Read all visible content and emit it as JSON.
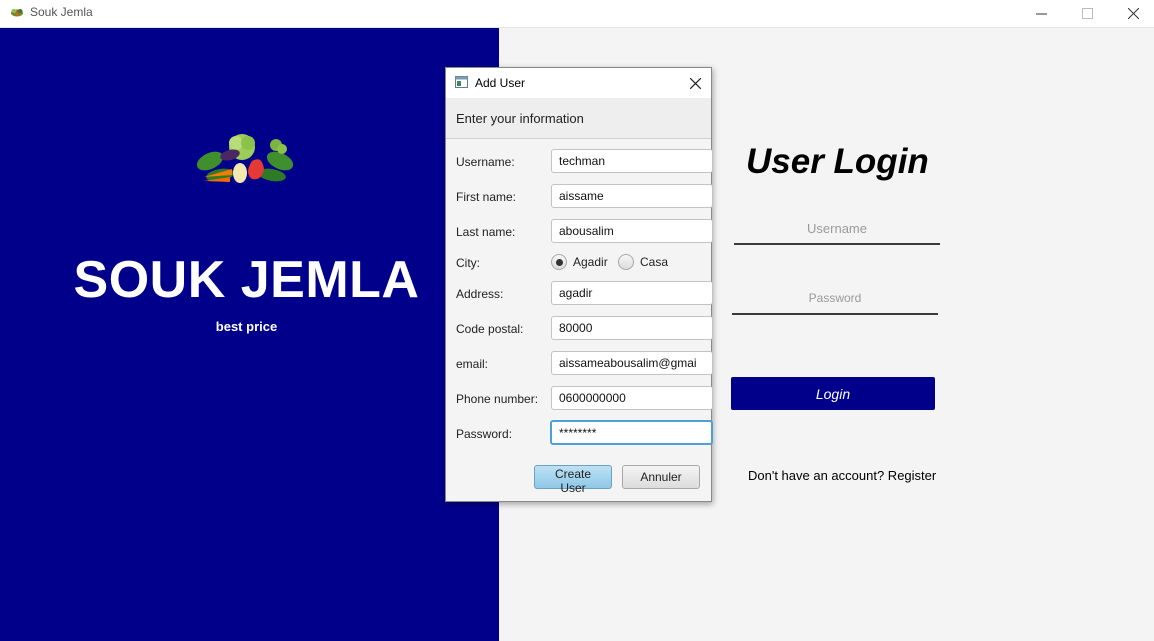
{
  "window": {
    "title": "Souk Jemla",
    "controls": {
      "minimize": "—",
      "maximize": "☐",
      "close": "✕"
    }
  },
  "brand": {
    "title": "SOUK JEMLA",
    "subtitle": "best price",
    "logo_icon": "vegetables-basket-icon",
    "panel_color": "#00008b"
  },
  "login": {
    "title": "User Login",
    "username_placeholder": "Username",
    "password_placeholder": "Password",
    "button_label": "Login",
    "register_text": "Don't have an account? Register",
    "button_color": "#00008b"
  },
  "dialog": {
    "title": "Add User",
    "header": "Enter your information",
    "close_icon": "✕",
    "fields": {
      "username": {
        "label": "Username:",
        "value": "techman"
      },
      "first_name": {
        "label": "First name:",
        "value": "aissame"
      },
      "last_name": {
        "label": "Last name:",
        "value": "abousalim"
      },
      "city": {
        "label": "City:",
        "options": [
          "Agadir",
          "Casa"
        ],
        "selected": "Agadir"
      },
      "address": {
        "label": "Address:",
        "value": "agadir"
      },
      "code_postal": {
        "label": "Code postal:",
        "value": "80000"
      },
      "email": {
        "label": "email:",
        "value": "aissameabousalim@gmai"
      },
      "phone": {
        "label": "Phone number:",
        "value": "0600000000"
      },
      "password": {
        "label": "Password:",
        "value": "********"
      }
    },
    "create_button": "Create User",
    "cancel_button": "Annuler"
  }
}
